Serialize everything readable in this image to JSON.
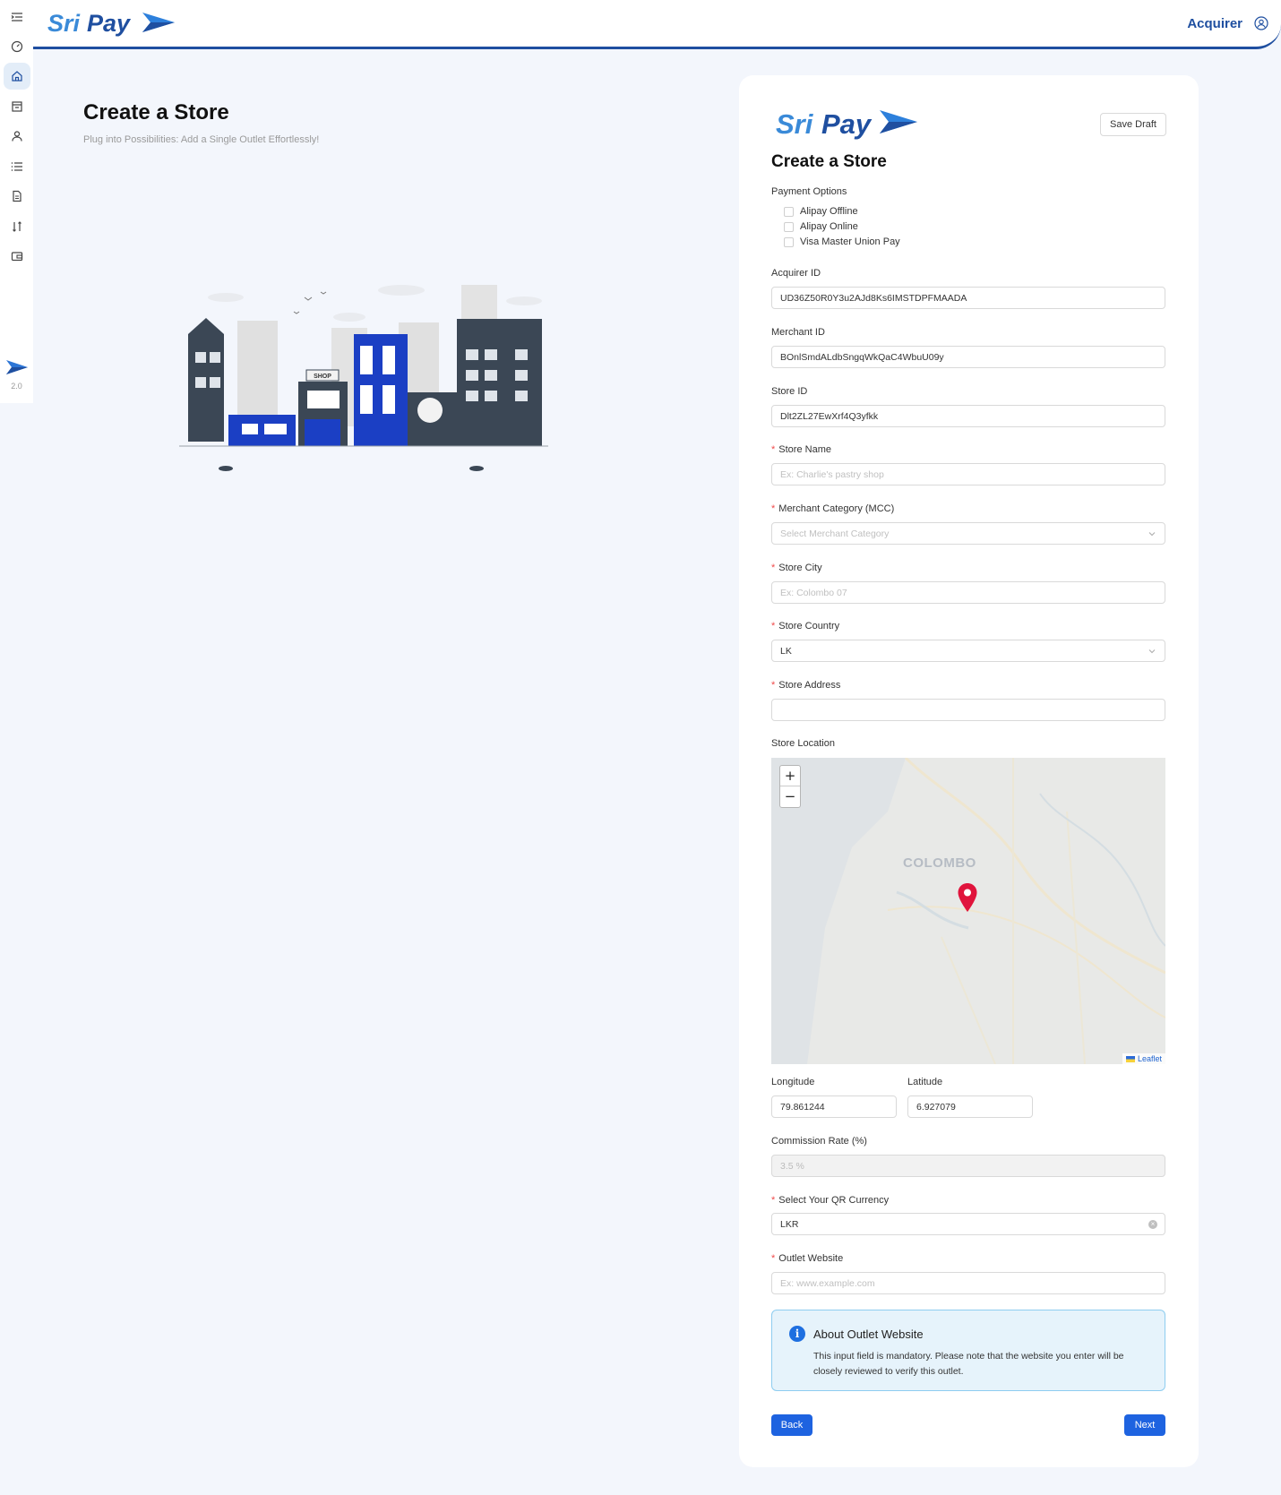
{
  "header": {
    "brand": "SriPay",
    "role": "Acquirer"
  },
  "sidebar": {
    "version": "2.0",
    "items": [
      {
        "name": "menu-toggle-icon"
      },
      {
        "name": "dashboard-icon"
      },
      {
        "name": "home-icon",
        "active": true
      },
      {
        "name": "store-icon"
      },
      {
        "name": "user-icon"
      },
      {
        "name": "list-icon"
      },
      {
        "name": "document-icon"
      },
      {
        "name": "transactions-icon"
      },
      {
        "name": "wallet-icon"
      }
    ]
  },
  "page": {
    "title": "Create a Store",
    "subtitle": "Plug into Possibilities: Add a Single Outlet Effortlessly!"
  },
  "form": {
    "brand": "SriPay",
    "save_draft": "Save Draft",
    "title": "Create a Store",
    "payment_options_label": "Payment Options",
    "payment_options": [
      "Alipay Offline",
      "Alipay Online",
      "Visa Master Union Pay"
    ],
    "acquirer_id": {
      "label": "Acquirer ID",
      "value": "UD36Z50R0Y3u2AJd8Ks6IMSTDPFMAADA"
    },
    "merchant_id": {
      "label": "Merchant ID",
      "value": "BOnlSmdALdbSngqWkQaC4WbuU09y"
    },
    "store_id": {
      "label": "Store ID",
      "value": "Dlt2ZL27EwXrf4Q3yfkk"
    },
    "store_name": {
      "label": "Store Name",
      "placeholder": "Ex: Charlie's pastry shop"
    },
    "merchant_category": {
      "label": "Merchant Category (MCC)",
      "placeholder": "Select Merchant Category"
    },
    "store_city": {
      "label": "Store City",
      "placeholder": "Ex: Colombo 07"
    },
    "store_country": {
      "label": "Store Country",
      "value": "LK"
    },
    "store_address": {
      "label": "Store Address",
      "value": ""
    },
    "store_location": {
      "label": "Store Location",
      "map_city": "COLOMBO",
      "zoom_in": "+",
      "zoom_out": "−",
      "attribution": "Leaflet"
    },
    "longitude": {
      "label": "Longitude",
      "value": "79.861244"
    },
    "latitude": {
      "label": "Latitude",
      "value": "6.927079"
    },
    "commission_rate": {
      "label": "Commission Rate (%)",
      "value": "3.5 %"
    },
    "qr_currency": {
      "label": "Select Your QR Currency",
      "value": "LKR"
    },
    "outlet_website": {
      "label": "Outlet Website",
      "placeholder": "Ex: www.example.com"
    },
    "info": {
      "title": "About Outlet Website",
      "text": "This input field is mandatory. Please note that the website you enter will be closely reviewed to verify this outlet."
    },
    "back": "Back",
    "next": "Next"
  },
  "colors": {
    "brand_blue": "#1f4fa0",
    "primary": "#1e63e0",
    "pin": "#e0143c"
  }
}
